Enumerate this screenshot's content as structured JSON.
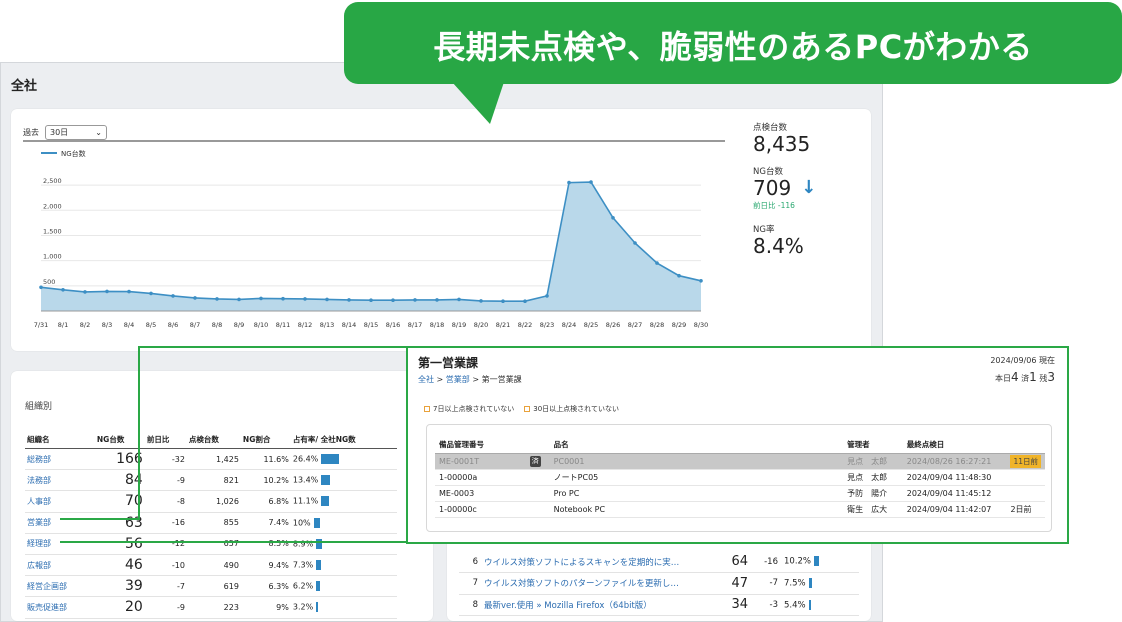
{
  "callout": {
    "text": "長期未点検や、脆弱性のあるPCがわかる"
  },
  "app": {
    "title": "全社"
  },
  "period": {
    "label": "過去",
    "selected": "30日"
  },
  "chart_data": {
    "type": "area",
    "legend": "NG台数",
    "x": [
      "7/31",
      "8/1",
      "8/2",
      "8/3",
      "8/4",
      "8/5",
      "8/6",
      "8/7",
      "8/8",
      "8/9",
      "8/10",
      "8/11",
      "8/12",
      "8/13",
      "8/14",
      "8/15",
      "8/16",
      "8/17",
      "8/18",
      "8/19",
      "8/20",
      "8/21",
      "8/22",
      "8/23",
      "8/24",
      "8/25",
      "8/26",
      "8/27",
      "8/28",
      "8/29",
      "8/30"
    ],
    "values": [
      470,
      420,
      380,
      390,
      385,
      350,
      300,
      260,
      240,
      230,
      250,
      245,
      240,
      230,
      220,
      215,
      215,
      220,
      220,
      230,
      200,
      195,
      195,
      300,
      2550,
      2560,
      1850,
      1350,
      950,
      700,
      600
    ],
    "yticks": [
      "500",
      "1,000",
      "1,500",
      "2,000",
      "2,500"
    ],
    "ytick_values": [
      500,
      1000,
      1500,
      2000,
      2500
    ],
    "ylim": [
      0,
      2700
    ],
    "color": "#3d8fc4",
    "fill": "#b9d8ea"
  },
  "stats": {
    "inspected_label": "点検台数",
    "inspected_value": "8,435",
    "ng_label": "NG台数",
    "ng_value": "709",
    "ng_delta": "前日比 -116",
    "ng_rate_label": "NG率",
    "ng_rate_value": "8.4%"
  },
  "org": {
    "title": "組織別",
    "headers": [
      "組織名",
      "NG台数",
      "前日比",
      "点検台数",
      "NG割合",
      "占有率/ 全社NG数"
    ],
    "rows": [
      {
        "name": "総務部",
        "ng": "166",
        "delta": "-32",
        "checked": "1,425",
        "ratio": "11.6%",
        "share": "26.4%",
        "share_value": 26.4
      },
      {
        "name": "法務部",
        "ng": "84",
        "delta": "-9",
        "checked": "821",
        "ratio": "10.2%",
        "share": "13.4%",
        "share_value": 13.4
      },
      {
        "name": "人事部",
        "ng": "70",
        "delta": "-8",
        "checked": "1,026",
        "ratio": "6.8%",
        "share": "11.1%",
        "share_value": 11.1
      },
      {
        "name": "営業部",
        "ng": "63",
        "delta": "-16",
        "checked": "855",
        "ratio": "7.4%",
        "share": "10%",
        "share_value": 10
      },
      {
        "name": "経理部",
        "ng": "56",
        "delta": "-12",
        "checked": "657",
        "ratio": "8.5%",
        "share": "8.9%",
        "share_value": 8.9
      },
      {
        "name": "広報部",
        "ng": "46",
        "delta": "-10",
        "checked": "490",
        "ratio": "9.4%",
        "share": "7.3%",
        "share_value": 7.3
      },
      {
        "name": "経営企画部",
        "ng": "39",
        "delta": "-7",
        "checked": "619",
        "ratio": "6.3%",
        "share": "6.2%",
        "share_value": 6.2
      },
      {
        "name": "販売促進部",
        "ng": "20",
        "delta": "-9",
        "checked": "223",
        "ratio": "9%",
        "share": "3.2%",
        "share_value": 3.2
      }
    ]
  },
  "vuln": {
    "rows": [
      {
        "no": "6",
        "name": "ウイルス対策ソフトによるスキャンを定期的に実…",
        "ng": "64",
        "delta": "-16",
        "rate": "10.2%",
        "share_value": 10.2
      },
      {
        "no": "7",
        "name": "ウイルス対策ソフトのパターンファイルを更新し…",
        "ng": "47",
        "delta": "-7",
        "rate": "7.5%",
        "share_value": 7.5
      },
      {
        "no": "8",
        "name": "最新ver.使用 » Mozilla Firefox（64bit版）",
        "ng": "34",
        "delta": "-3",
        "rate": "5.4%",
        "share_value": 5.4
      }
    ]
  },
  "detail": {
    "title": "第一営業課",
    "breadcrumb": [
      "全社",
      "営業部",
      "第一営業課"
    ],
    "date": "2024/09/06 現在",
    "counts": {
      "honbi_label": "本日",
      "honbi": "4",
      "ryo_label": "済",
      "ryo": "1",
      "rest_label": "残",
      "rest": "3"
    },
    "legend": [
      "7日以上点検されていない",
      "30日以上点検されていない"
    ],
    "headers": [
      "備品管理番号",
      "",
      "品名",
      "管理者",
      "最終点検日",
      ""
    ],
    "rows": [
      {
        "id": "ME-0001T",
        "badge": "済",
        "name": "PC0001",
        "owner": "見点　太郎",
        "date": "2024/08/26 16:27:21",
        "note": "11日前",
        "grey": true
      },
      {
        "id": "1-00000a",
        "badge": "",
        "name": "ノートPC05",
        "owner": "見点　太郎",
        "date": "2024/09/04 11:48:30",
        "note": "",
        "grey": false
      },
      {
        "id": "ME-0003",
        "badge": "",
        "name": "Pro PC",
        "owner": "予防　陽介",
        "date": "2024/09/04 11:45:12",
        "note": "",
        "grey": false
      },
      {
        "id": "1-00000c",
        "badge": "",
        "name": "Notebook PC",
        "owner": "衛生　広大",
        "date": "2024/09/04 11:42:07",
        "note": "2日前",
        "grey": false
      }
    ]
  }
}
